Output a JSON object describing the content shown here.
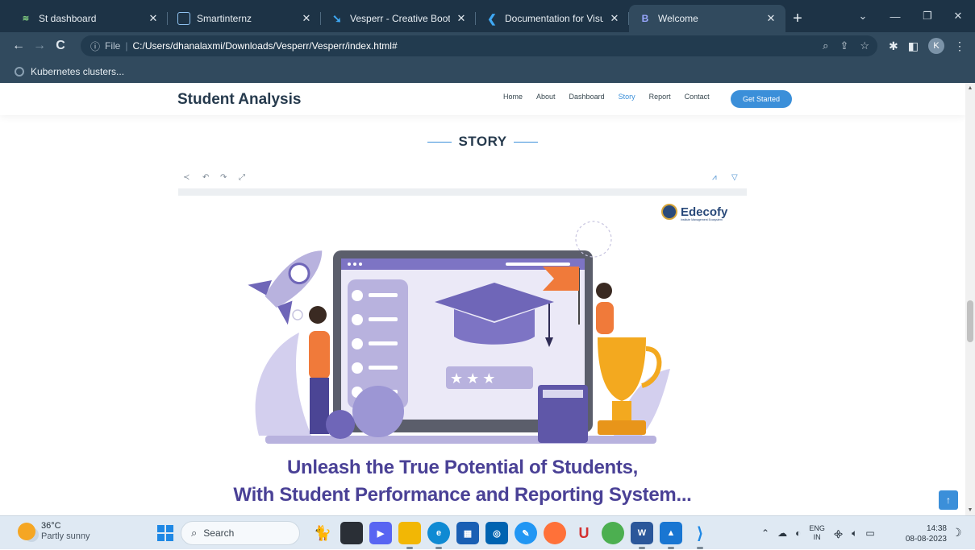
{
  "browser": {
    "tabs": [
      {
        "title": "St dashboard",
        "fav_color": "#2e7d32",
        "fav_glyph": "≋"
      },
      {
        "title": "Smartinternz",
        "fav_color": "#1e88e5",
        "fav_glyph": "□"
      },
      {
        "title": "Vesperr - Creative Bootstrap",
        "fav_color": "#1e88e5",
        "fav_glyph": "❯"
      },
      {
        "title": "Documentation for Visual Stu",
        "fav_color": "#1e88e5",
        "fav_glyph": "❮"
      },
      {
        "title": "Welcome",
        "fav_color": "#4a63d9",
        "fav_glyph": "B"
      }
    ],
    "tab_close": "✕",
    "new_tab": "+",
    "address": {
      "info": "ⓘ",
      "scheme_label": "File",
      "url": "C:/Users/dhanalaxmi/Downloads/Vesperr/Vesperr/index.html#"
    },
    "profile_initial": "K",
    "bookmark": "Kubernetes clusters..."
  },
  "site": {
    "brand": "Student Analysis",
    "nav": [
      "Home",
      "About",
      "Dashboard",
      "Story",
      "Report",
      "Contact"
    ],
    "active_nav": "Story",
    "cta": "Get Started",
    "section_title": "STORY",
    "back_to_top": "↑"
  },
  "story": {
    "logo_name": "Edecofy",
    "logo_tagline": "Institute Management Ecosystem",
    "headline_1": "Unleash the True Potential of Students,",
    "headline_2": "With Student Performance and Reporting System...",
    "rating_stars": "★★★"
  },
  "taskbar": {
    "temperature": "36°C",
    "weather": "Partly sunny",
    "search_placeholder": "Search",
    "lang_1": "ENG",
    "lang_2": "IN",
    "time": "14:38",
    "date": "08-08-2023"
  }
}
